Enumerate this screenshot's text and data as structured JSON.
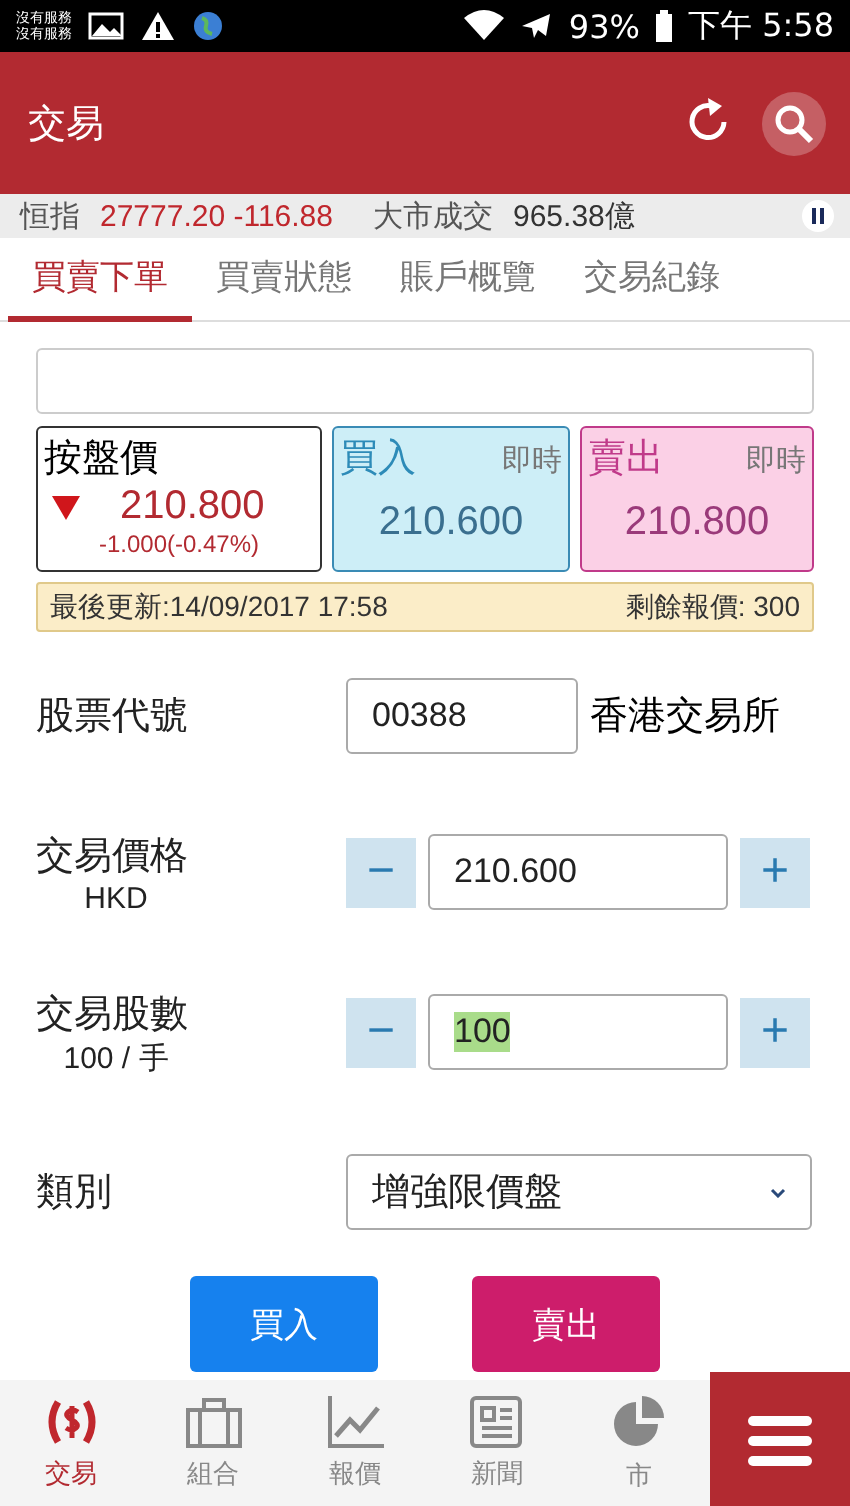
{
  "status_bar": {
    "carrier_lines": [
      "沒有服務",
      "沒有服務"
    ],
    "battery": "93%",
    "time": "下午 5:58"
  },
  "app_bar": {
    "title": "交易"
  },
  "ticker": {
    "items": [
      {
        "label": "恒指",
        "value": "27777.20 -116.88",
        "falling": true
      },
      {
        "label": "大市成交",
        "value": "965.38億",
        "falling": false
      }
    ]
  },
  "tabs": [
    {
      "label": "買賣下單",
      "selected": true
    },
    {
      "label": "買賣狀態",
      "selected": false
    },
    {
      "label": "賬戶概覽",
      "selected": false
    },
    {
      "label": "交易紀錄",
      "selected": false
    }
  ],
  "quote": {
    "nominal": {
      "label": "按盤價",
      "price": "210.800",
      "change": "-1.000(-0.47%)",
      "falling": true
    },
    "bid": {
      "label": "買入",
      "tag": "即時",
      "price": "210.600"
    },
    "ask": {
      "label": "賣出",
      "tag": "即時",
      "price": "210.800"
    }
  },
  "update_bar": {
    "last_update": "最後更新:14/09/2017 17:58",
    "remaining": "剩餘報價: 300"
  },
  "form": {
    "stock_code": {
      "label": "股票代號",
      "value": "00388",
      "exchange": "香港交易所"
    },
    "price": {
      "label": "交易價格",
      "sublabel": "HKD",
      "minus": "−",
      "value": "210.600",
      "plus": "+",
      "value_selected": false
    },
    "quantity": {
      "label": "交易股數",
      "sublabel": "100 / 手",
      "minus": "−",
      "value": "100",
      "plus": "+",
      "value_selected": true
    },
    "order_type": {
      "label": "類別",
      "value": "增強限價盤"
    }
  },
  "actions": [
    {
      "label": "買入",
      "kind": "buy"
    },
    {
      "label": "賣出",
      "kind": "sell"
    }
  ],
  "bottom_nav": {
    "items": [
      {
        "label": "交易",
        "kind": "trade",
        "selected": true
      },
      {
        "label": "組合",
        "kind": "portfolio",
        "selected": false
      },
      {
        "label": "報價",
        "kind": "chart",
        "selected": false
      },
      {
        "label": "新聞",
        "kind": "news",
        "selected": false
      },
      {
        "label": "市",
        "kind": "pie",
        "selected": false
      }
    ]
  }
}
